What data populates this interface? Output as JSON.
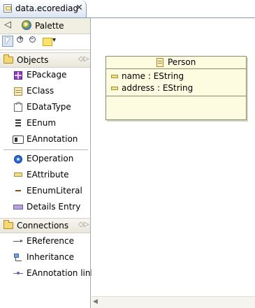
{
  "tab": {
    "title": "data.ecorediag",
    "close_glyph": "✕"
  },
  "palette": {
    "back_glyph": "◁",
    "title": "Palette",
    "tools": [
      "select-tool",
      "zoom-in-tool",
      "zoom-out-tool",
      "note-tool"
    ],
    "drawers": [
      {
        "label": "Objects",
        "pin_glyph": "◇▷",
        "items": [
          {
            "label": "EPackage",
            "icon": "package-icon"
          },
          {
            "label": "EClass",
            "icon": "class-icon"
          },
          {
            "label": "EDataType",
            "icon": "datatype-icon"
          },
          {
            "label": "EEnum",
            "icon": "enum-icon"
          },
          {
            "label": "EAnnotation",
            "icon": "annotation-icon"
          },
          {
            "label": "EOperation",
            "icon": "operation-icon"
          },
          {
            "label": "EAttribute",
            "icon": "attribute-icon"
          },
          {
            "label": "EEnumLiteral",
            "icon": "enum-literal-icon"
          },
          {
            "label": "Details Entry",
            "icon": "details-entry-icon"
          }
        ]
      },
      {
        "label": "Connections",
        "pin_glyph": "◇▷",
        "items": [
          {
            "label": "EReference",
            "icon": "reference-icon"
          },
          {
            "label": "Inheritance",
            "icon": "inheritance-icon"
          },
          {
            "label": "EAnnotation link",
            "icon": "annotation-link-icon"
          }
        ]
      }
    ]
  },
  "diagram": {
    "class": {
      "name": "Person",
      "attributes": [
        "name : EString",
        "address : EString"
      ]
    }
  },
  "scrollbar": {
    "left_glyph": "◀"
  }
}
